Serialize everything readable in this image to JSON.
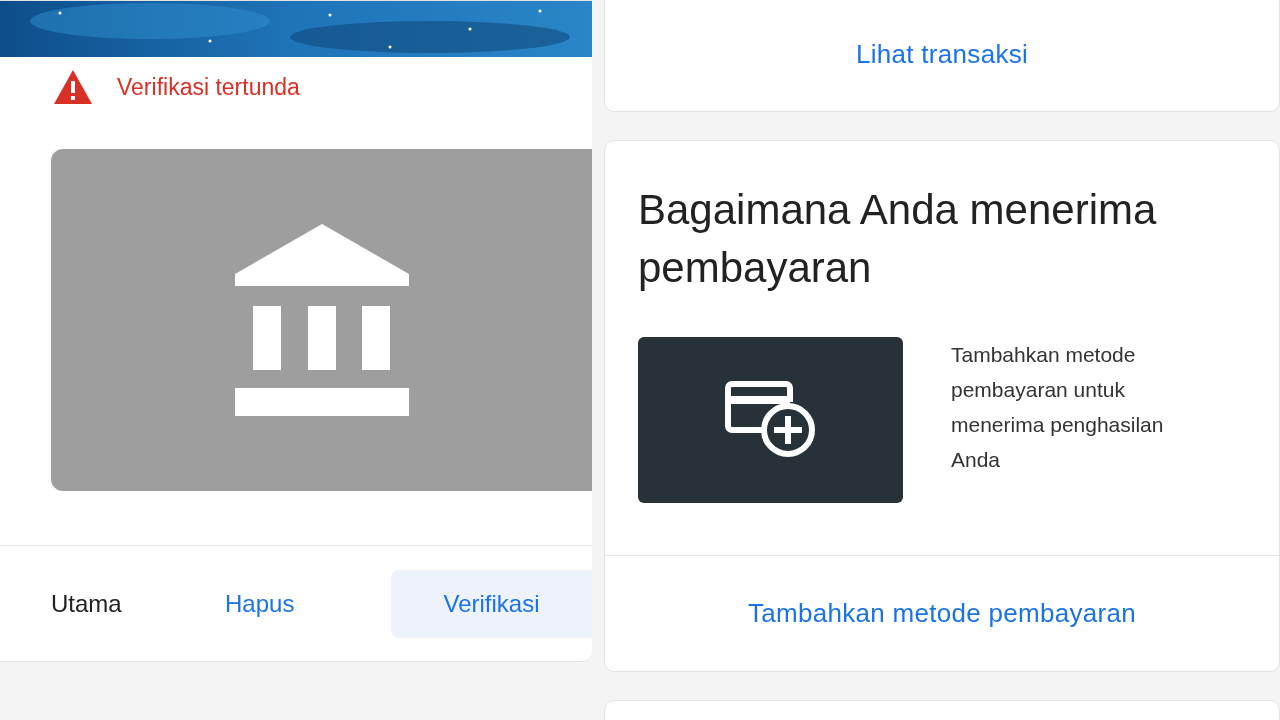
{
  "left": {
    "status": {
      "kind": "warning",
      "text": "Verifikasi tertunda"
    },
    "actions": [
      {
        "kind": "text",
        "label": "Utama"
      },
      {
        "kind": "link",
        "label": "Hapus"
      },
      {
        "kind": "button",
        "label": "Verifikasi"
      }
    ]
  },
  "right": {
    "link": "Lihat transaksi",
    "title": "Bagaimana Anda menerima pembayaran",
    "description": "Tambahkan metode pembayaran untuk menerima penghasilan Anda",
    "action": "Tambahkan metode pembayaran"
  }
}
